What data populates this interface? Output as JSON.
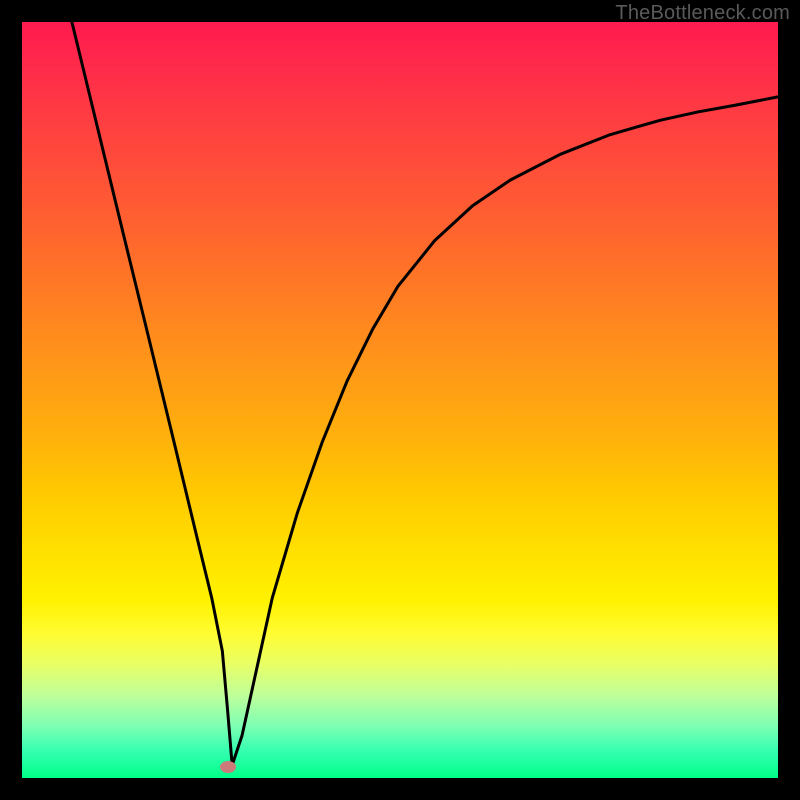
{
  "watermark": "TheBottleneck.com",
  "marker": {
    "x_frac": 0.272,
    "y_frac": 0.986
  },
  "chart_data": {
    "type": "line",
    "title": "",
    "xlabel": "",
    "ylabel": "",
    "xlim": [
      0,
      100
    ],
    "ylim": [
      0,
      100
    ],
    "grid": false,
    "legend": false,
    "description": "Bottleneck curve: V-shaped profile with a sharp minimum. Left of the minimum descends near-linearly from top-left; right of the minimum rises with decreasing slope toward a plateau at upper right. Background vertical gradient encodes badness (red high, green low).",
    "series": [
      {
        "name": "bottleneck-curve",
        "x": [
          6.6,
          9.9,
          13.2,
          16.5,
          19.9,
          23.2,
          25.1,
          26.5,
          27.2,
          27.8,
          29.1,
          31.1,
          33.1,
          36.4,
          39.7,
          43.0,
          46.4,
          49.7,
          54.6,
          59.6,
          64.6,
          71.2,
          77.8,
          84.4,
          89.4,
          94.4,
          100.0
        ],
        "y": [
          100.0,
          86.4,
          72.8,
          59.3,
          45.3,
          31.6,
          23.8,
          16.8,
          8.9,
          1.7,
          5.6,
          14.7,
          23.8,
          35.0,
          44.4,
          52.5,
          59.4,
          65.0,
          71.1,
          75.7,
          79.1,
          82.5,
          85.1,
          87.0,
          88.1,
          89.0,
          90.1
        ]
      }
    ],
    "marker_point": {
      "x": 27.2,
      "y": 1.4,
      "color": "#cc7a7a"
    },
    "background_gradient": {
      "orientation": "vertical",
      "stops": [
        {
          "pos": 0.0,
          "color": "#ff1a4f"
        },
        {
          "pos": 0.5,
          "color": "#ffae0d"
        },
        {
          "pos": 0.8,
          "color": "#fffc33"
        },
        {
          "pos": 1.0,
          "color": "#00ff88"
        }
      ]
    }
  }
}
